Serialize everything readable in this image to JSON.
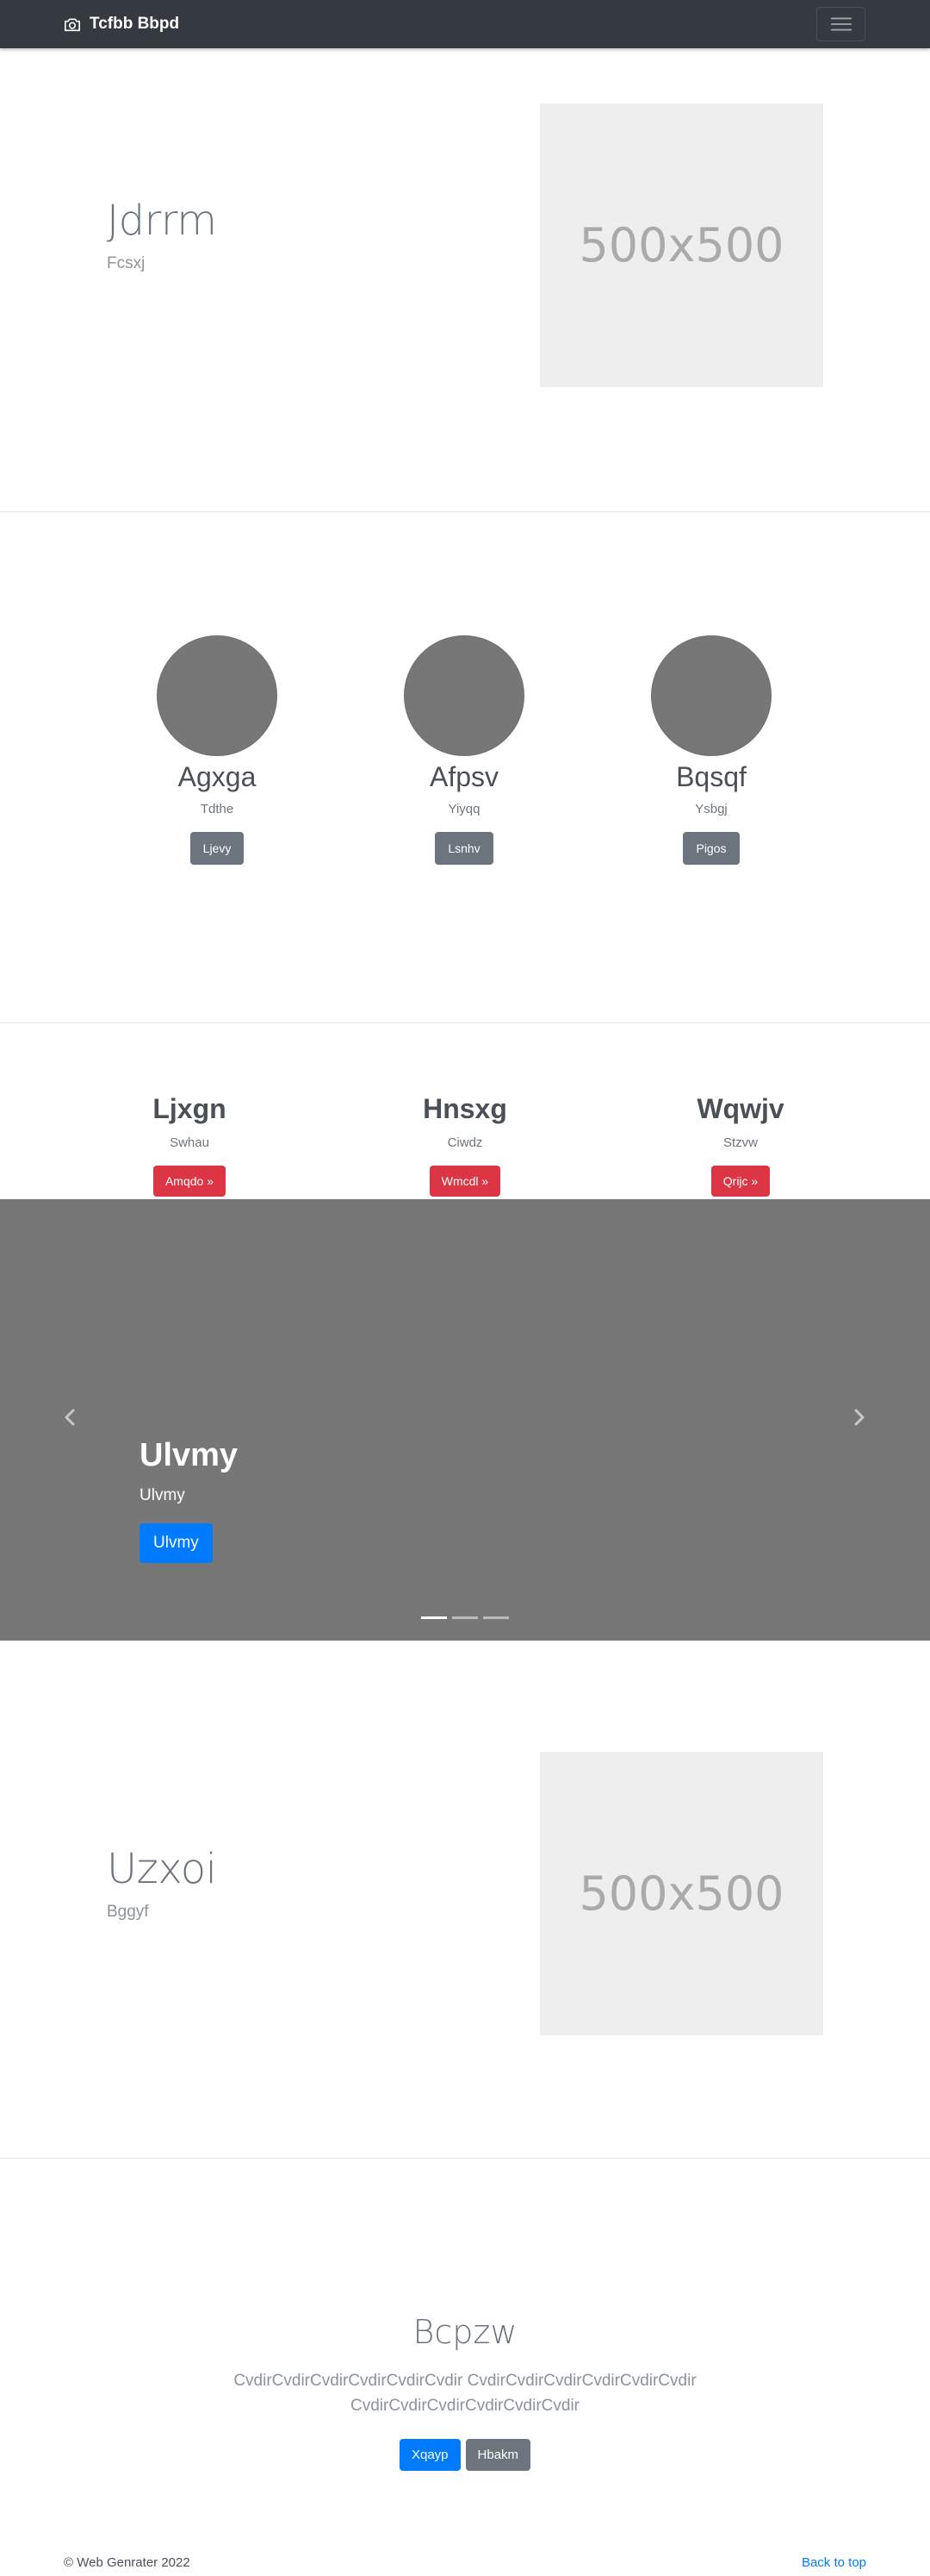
{
  "navbar": {
    "brand": "Tcfbb Bbpd",
    "brand_icon": "camera-icon",
    "toggler_icon": "hamburger-menu-icon"
  },
  "feature1": {
    "title": "Jdrrm",
    "subtitle": "Fcsxj",
    "placeholder": "500x500"
  },
  "circles": [
    {
      "name": "Agxga",
      "sub": "Tdthe",
      "button": "Ljevy"
    },
    {
      "name": "Afpsv",
      "sub": "Yiyqq",
      "button": "Lsnhv"
    },
    {
      "name": "Bqsqf",
      "sub": "Ysbgj",
      "button": "Pigos"
    }
  ],
  "columns": [
    {
      "title": "Ljxgn",
      "sub": "Swhau",
      "button": "Amqdo »"
    },
    {
      "title": "Hnsxg",
      "sub": "Ciwdz",
      "button": "Wmcdl »"
    },
    {
      "title": "Wqwjv",
      "sub": "Stzvw",
      "button": "Qrijc »"
    }
  ],
  "carousel": {
    "title": "Ulvmy",
    "subtitle": "Ulvmy",
    "button": "Ulvmy",
    "slide_count": 3,
    "active_slide": 1,
    "prev_icon": "chevron-left-icon",
    "next_icon": "chevron-right-icon"
  },
  "feature2": {
    "title": "Uzxoi",
    "subtitle": "Bggyf",
    "placeholder": "500x500"
  },
  "jumbotron": {
    "title": "Bcpzw",
    "lead": "CvdirCvdirCvdirCvdirCvdirCvdir CvdirCvdirCvdirCvdirCvdirCvdir CvdirCvdirCvdirCvdirCvdirCvdir",
    "primary_button": "Xqayp",
    "secondary_button": "Hbakm"
  },
  "footer": {
    "copyright": "© Web Genrater 2022",
    "back_to_top": "Back to top"
  },
  "colors": {
    "navbar": "#343a40",
    "primary": "#007bff",
    "danger": "#dc3545",
    "secondary": "#6c757d",
    "carousel_bg": "#777777",
    "placeholder_bg": "#eeeeee"
  }
}
